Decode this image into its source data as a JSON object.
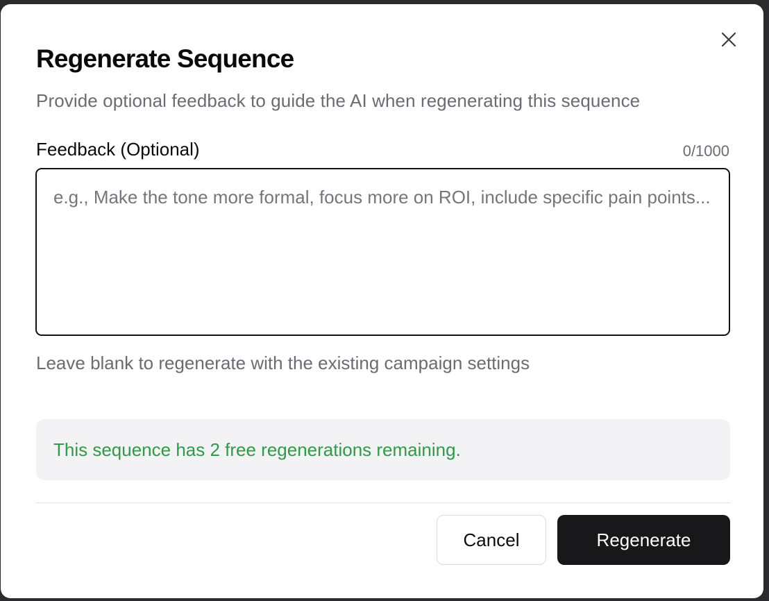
{
  "dialog": {
    "title": "Regenerate Sequence",
    "subtitle": "Provide optional feedback to guide the AI when regenerating this sequence",
    "close_icon": "close-icon"
  },
  "feedback": {
    "label": "Feedback (Optional)",
    "char_count": "0/1000",
    "value": "",
    "placeholder": "e.g., Make the tone more formal, focus more on ROI, include specific pain points...",
    "hint": "Leave blank to regenerate with the existing campaign settings"
  },
  "notice": {
    "text": "This sequence has 2 free regenerations remaining.",
    "color": "#2e9b46"
  },
  "actions": {
    "cancel_label": "Cancel",
    "regenerate_label": "Regenerate"
  },
  "colors": {
    "primary_button": "#18181b",
    "notice_background": "#f3f3f5"
  }
}
